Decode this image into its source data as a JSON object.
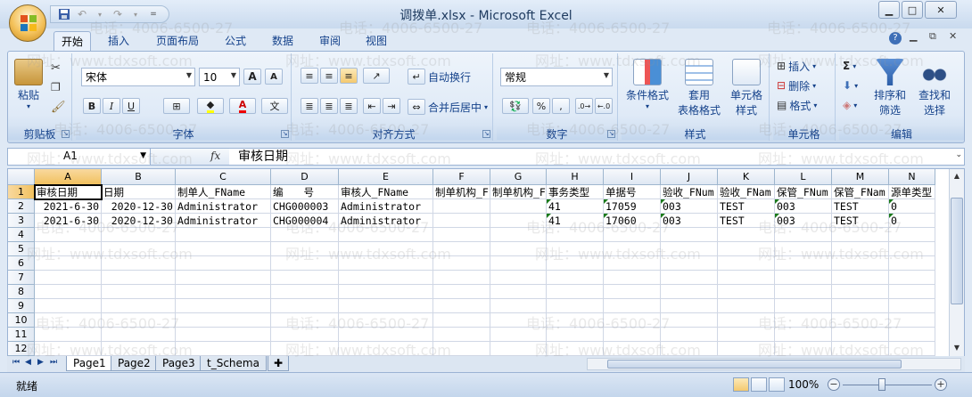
{
  "window": {
    "title": "调拨单.xlsx - Microsoft Excel"
  },
  "qat": {
    "save": "save-icon",
    "undo": "undo-icon",
    "redo": "redo-icon",
    "customize": "customize-icon"
  },
  "tabs": [
    "开始",
    "插入",
    "页面布局",
    "公式",
    "数据",
    "审阅",
    "视图"
  ],
  "ribbon": {
    "clipboard": {
      "label": "剪贴板",
      "paste": "粘贴"
    },
    "font": {
      "label": "字体",
      "name": "宋体",
      "size": "10",
      "bold": "B",
      "italic": "I",
      "underline": "U",
      "grow": "A",
      "shrink": "A",
      "phonetic": "文"
    },
    "alignment": {
      "label": "对齐方式",
      "wrap": "自动换行",
      "merge": "合并后居中"
    },
    "number": {
      "label": "数字",
      "format": "常规",
      "percent": "%",
      "comma": ","
    },
    "styles": {
      "label": "样式",
      "conditional": "条件格式",
      "table": "套用",
      "table2": "表格格式",
      "cell": "单元格",
      "cell2": "样式"
    },
    "cells": {
      "label": "单元格",
      "insert": "插入",
      "delete": "删除",
      "format": "格式"
    },
    "editing": {
      "label": "编辑",
      "sort": "排序和",
      "sort2": "筛选",
      "find": "查找和",
      "find2": "选择"
    }
  },
  "formula_bar": {
    "name_box": "A1",
    "fx": "fx",
    "content": "审核日期"
  },
  "columns": [
    "A",
    "B",
    "C",
    "D",
    "E",
    "F",
    "G",
    "H",
    "I",
    "J",
    "K",
    "L",
    "M",
    "N"
  ],
  "row_numbers": [
    "1",
    "2",
    "3",
    "4",
    "5",
    "6",
    "7",
    "8",
    "9",
    "10",
    "11",
    "12"
  ],
  "rows": [
    [
      "审核日期",
      "日期",
      "制单人_FName",
      "编　　号",
      "审核人_FName",
      "制单机构_F",
      "制单机构_F",
      "事务类型",
      "单据号",
      "验收_FNum",
      "验收_FNam",
      "保管_FNum",
      "保管_FNam",
      "源单类型"
    ],
    [
      "2021-6-30",
      "2020-12-30",
      "Administrator",
      "CHG000003",
      "Administrator",
      "",
      "",
      "41",
      "17059",
      "003",
      "TEST",
      "003",
      "TEST",
      "0"
    ],
    [
      "2021-6-30",
      "2020-12-30",
      "Administrator",
      "CHG000004",
      "Administrator",
      "",
      "",
      "41",
      "17060",
      "003",
      "TEST",
      "003",
      "TEST",
      "0"
    ]
  ],
  "sheet_tabs": [
    "Page1",
    "Page2",
    "Page3",
    "t_Schema"
  ],
  "status": {
    "text": "就绪",
    "zoom": "100%"
  },
  "watermark": {
    "phone": "电话：4006-6500-27",
    "site": "网址：www.tdxsoft.com"
  }
}
